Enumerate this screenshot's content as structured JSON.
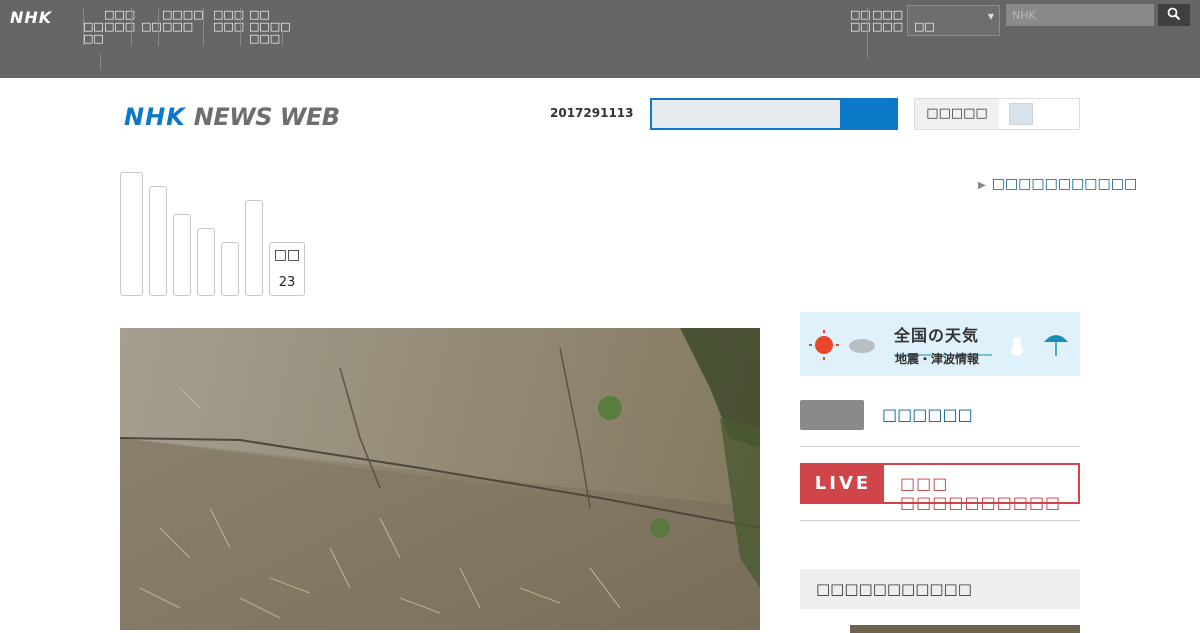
{
  "topbar": {
    "logo": "NHK",
    "nav_items": [
      "□□\n□□",
      "□□□\n□□□",
      "□□",
      "□□□□\n□□□",
      "□□□\n□□□",
      "□□\n□□□□\n□□□"
    ],
    "right_nav": [
      "□□\n□□",
      "□□□\n□□□"
    ],
    "select_value": "□□",
    "search_placeholder": "NHK",
    "search_icon": "magnifier-icon"
  },
  "header": {
    "logo_nhk": "NHK",
    "logo_newsweb": "NEWS WEB",
    "date": "2017291113",
    "search_value": "",
    "search_icon": "search-icon",
    "fontsize_label": "□□□□□"
  },
  "tabs": {
    "last_tab_line1": "□□",
    "last_tab_line2": "23"
  },
  "side_link": "□□□□□□□□□□□",
  "right_column": {
    "banner_title": "全国の天気",
    "banner_sub": "地震・津波情報",
    "link_label": "□□□□□□",
    "live_label": "LIVE",
    "live_text": "□□□ □□□□□□□□□□",
    "section_title": "□□□□□□□□□□□"
  },
  "colors": {
    "topbar": "#666666",
    "accent": "#0b79c8",
    "live": "#d0454a",
    "link": "#0b5c8f"
  }
}
